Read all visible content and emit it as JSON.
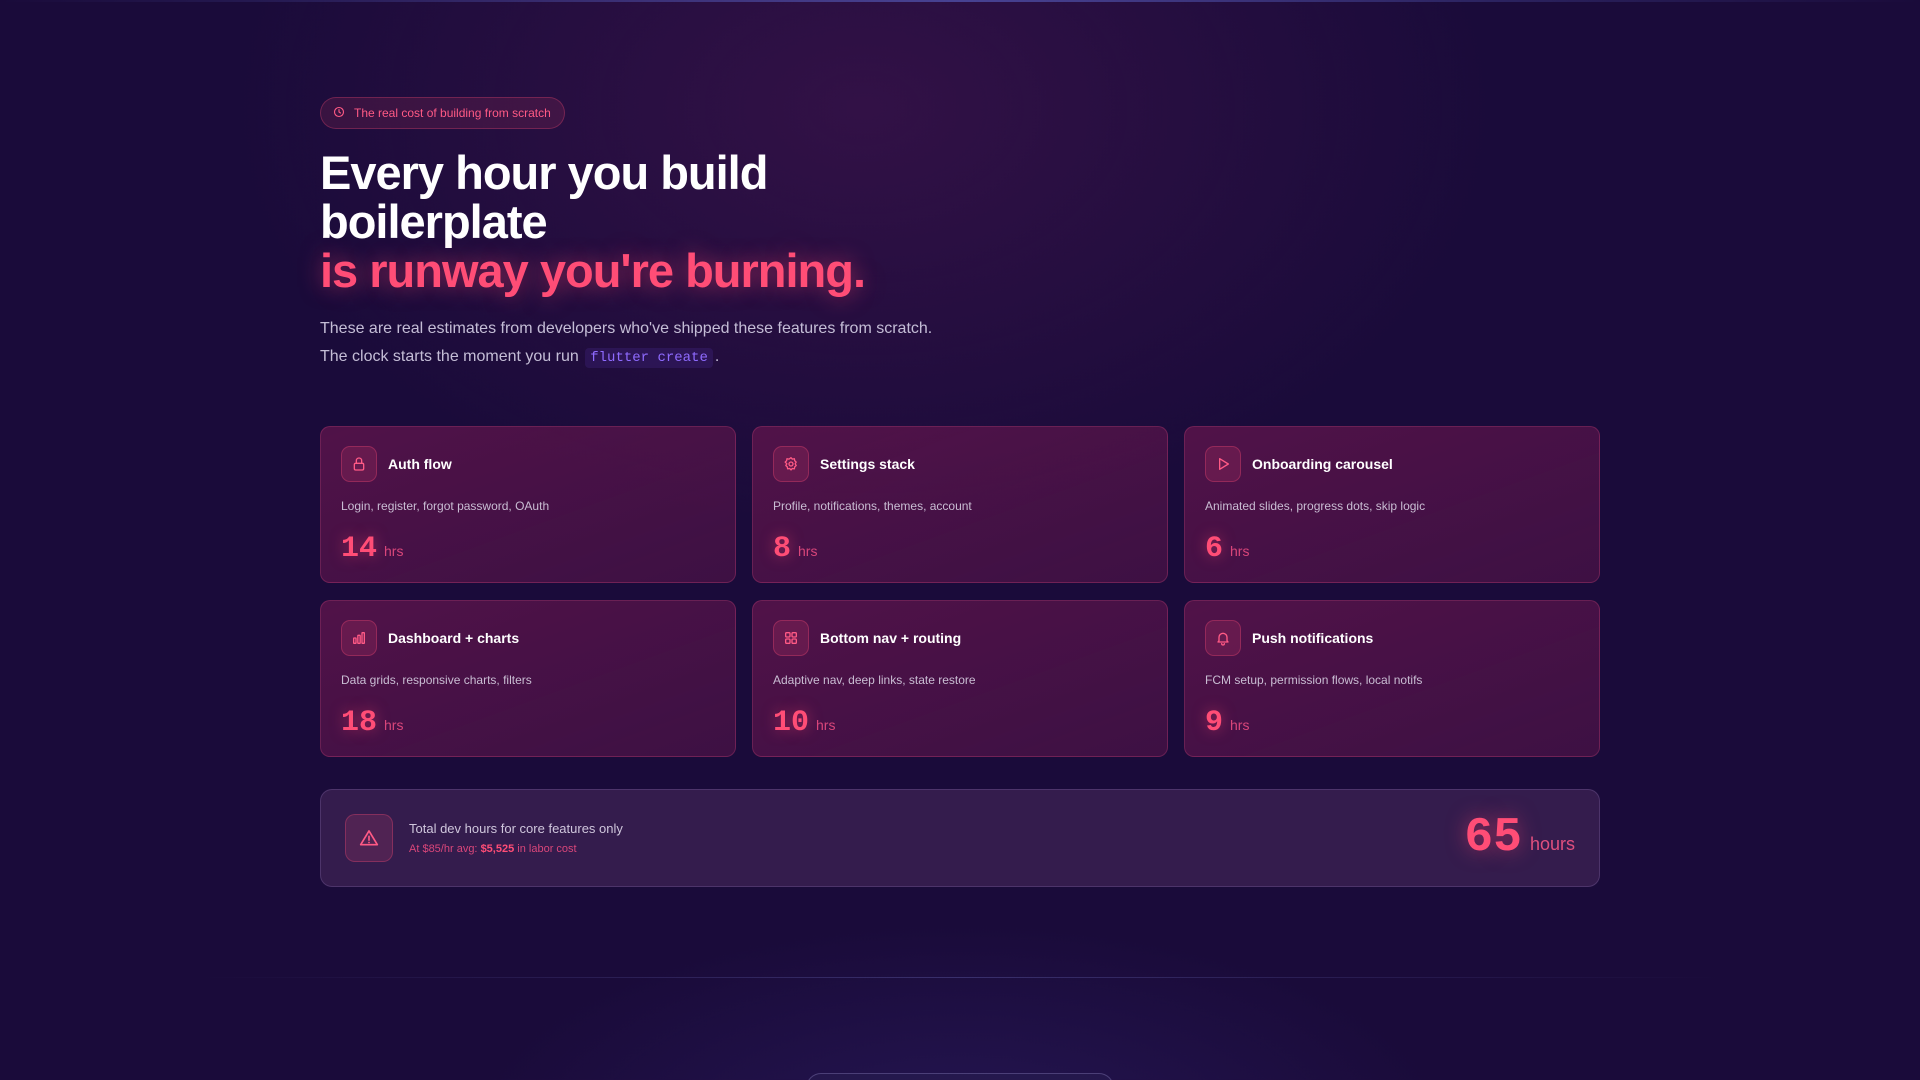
{
  "badge": {
    "icon": "clock-icon",
    "text": "The real cost of building from scratch"
  },
  "headline": {
    "line1": "Every hour you build",
    "line2": "boilerplate",
    "line3": "is runway you're burning."
  },
  "subtitle": {
    "line1": "These are real estimates from developers who've shipped these features from scratch.",
    "line2_prefix": "The clock starts the moment you run",
    "command": "flutter create",
    "line2_suffix": "."
  },
  "colors": {
    "accent": "#ff4d76",
    "background": "#1a0b3a",
    "code": "#8f6bff"
  },
  "features": [
    {
      "icon": "lock-icon",
      "title": "Auth flow",
      "description": "Login, register, forgot password, OAuth",
      "hours": "14",
      "unit": "hrs"
    },
    {
      "icon": "gear-icon",
      "title": "Settings stack",
      "description": "Profile, notifications, themes, account",
      "hours": "8",
      "unit": "hrs"
    },
    {
      "icon": "play-icon",
      "title": "Onboarding carousel",
      "description": "Animated slides, progress dots, skip logic",
      "hours": "6",
      "unit": "hrs"
    },
    {
      "icon": "bar-chart-icon",
      "title": "Dashboard + charts",
      "description": "Data grids, responsive charts, filters",
      "hours": "18",
      "unit": "hrs"
    },
    {
      "icon": "grid-icon",
      "title": "Bottom nav + routing",
      "description": "Adaptive nav, deep links, state restore",
      "hours": "10",
      "unit": "hrs"
    },
    {
      "icon": "bell-icon",
      "title": "Push notifications",
      "description": "FCM setup, permission flows, local notifs",
      "hours": "9",
      "unit": "hrs"
    }
  ],
  "total": {
    "icon": "warning-icon",
    "label": "Total dev hours for core features only",
    "rate_prefix": "At $85/hr avg:",
    "cost": "$5,525",
    "rate_suffix": "in labor cost",
    "hours": "65",
    "unit": "hours"
  }
}
